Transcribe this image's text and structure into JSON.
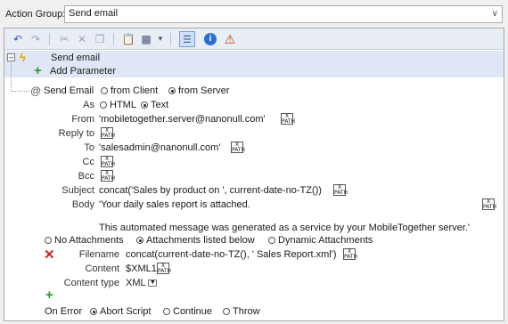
{
  "action_group": {
    "label": "Action Group:",
    "value": "Send email"
  },
  "toolbar": {
    "buttons": [
      "undo-icon",
      "redo-icon",
      "cut-icon",
      "delete-icon",
      "copy-icon",
      "paste-icon",
      "save-icon",
      "dropdown-icon",
      "list-view-icon",
      "info-icon",
      "warning-icon"
    ]
  },
  "action": {
    "title": "Send email",
    "add_parameter": "Add Parameter"
  },
  "send_email": {
    "label": "Send Email",
    "from_client": "from Client",
    "from_server": "from Server"
  },
  "fields": {
    "as_label": "As",
    "as_html": "HTML",
    "as_text": "Text",
    "from_label": "From",
    "from_value": "'mobiletogether.server@nanonull.com'",
    "reply_to_label": "Reply to",
    "to_label": "To",
    "to_value": "'salesadmin@nanonull.com'",
    "cc_label": "Cc",
    "bcc_label": "Bcc",
    "subject_label": "Subject",
    "subject_value": "concat('Sales by product on ', current-date-no-TZ())",
    "body_label": "Body",
    "body_line1": "'Your daily sales report is attached.",
    "body_line2": "This automated message was generated as a service by your MobileTogether server.'"
  },
  "attachments": {
    "none": "No Attachments",
    "listed": "Attachments listed below",
    "dynamic": "Dynamic Attachments",
    "filename_label": "Filename",
    "filename_value": "concat(current-date-no-TZ(), ' Sales Report.xml')",
    "content_label": "Content",
    "content_value": "$XML1",
    "content_type_label": "Content type",
    "content_type_value": "XML"
  },
  "on_error": {
    "label": "On Error",
    "abort": "Abort Script",
    "continue": "Continue",
    "throw": "Throw"
  },
  "xpath_icon": {
    "line1": "X",
    "line2": "PATH"
  }
}
